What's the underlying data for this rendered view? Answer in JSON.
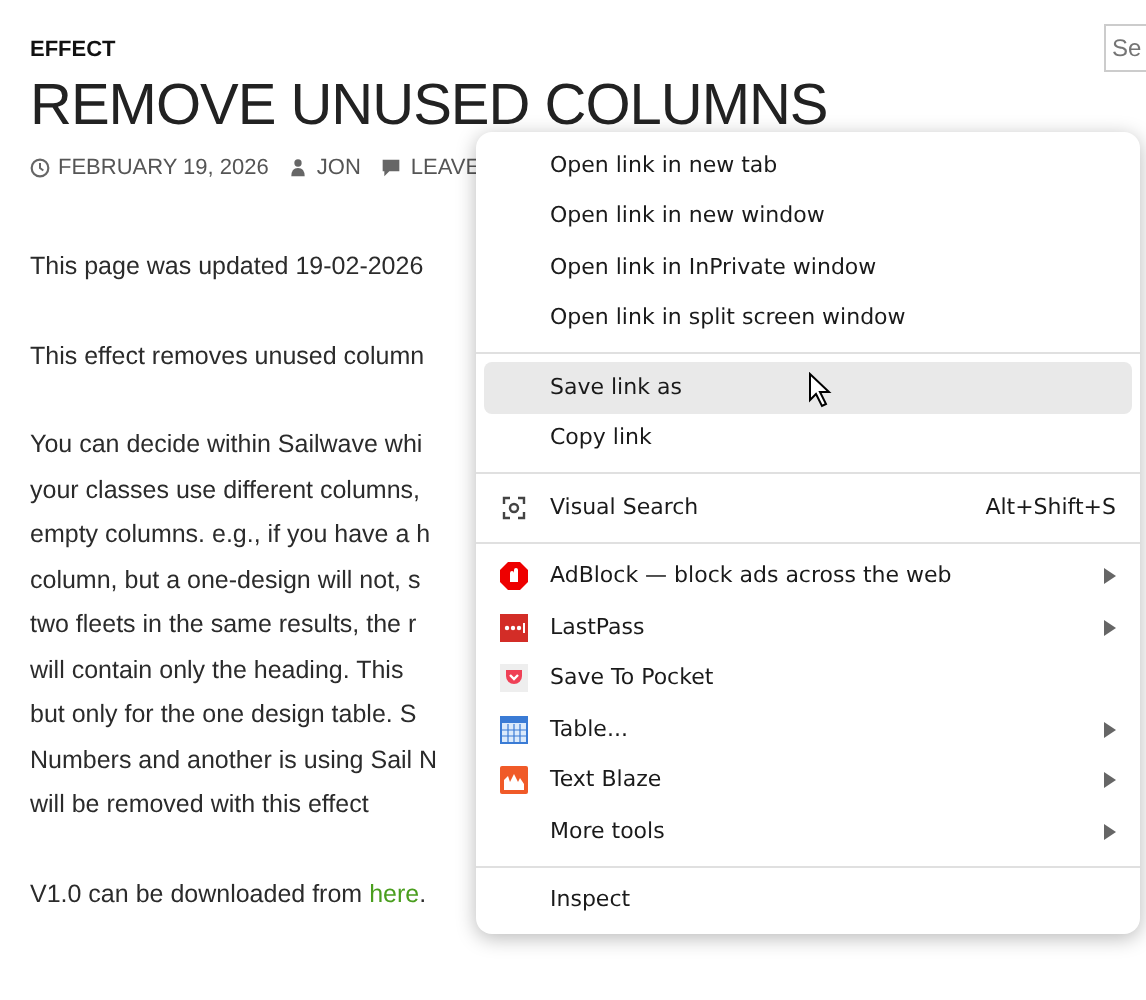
{
  "search": {
    "placeholder": "Se"
  },
  "article": {
    "category": "EFFECT",
    "title": "REMOVE UNUSED COLUMNS",
    "meta": [
      {
        "kind": "date",
        "text": "FEBRUARY 19, 2026"
      },
      {
        "kind": "author",
        "text": "JON"
      },
      {
        "kind": "comments",
        "text": "LEAVE"
      }
    ],
    "paragraphs": [
      [
        "This page was updated 19-02-2026"
      ],
      [
        "This effect removes unused column"
      ],
      [
        "You can decide within Sailwave whi",
        "your classes use different columns,",
        "empty columns.  e.g., if you have a h",
        "column, but a one-design will not, s",
        "two fleets in the same results, the r",
        "will contain only the heading.  This",
        "but only for the one design table.  S",
        "Numbers and another is using Sail N",
        "will be removed with this effect"
      ]
    ],
    "download": {
      "text": "V1.0  can be downloaded from ",
      "link": "here",
      "after": "."
    }
  },
  "context_menu": {
    "groups": [
      [
        {
          "label": "Open link in new tab",
          "selected": false
        },
        {
          "label": "Open link in new window",
          "selected": false
        },
        {
          "label": "Open link in InPrivate window",
          "selected": false
        },
        {
          "label": "Open link in split screen window",
          "selected": false
        }
      ],
      [
        {
          "label": "Save link as",
          "selected": true
        },
        {
          "label": "Copy link",
          "selected": false
        }
      ],
      [
        {
          "label": "Visual Search",
          "shortcut": "Alt+Shift+S",
          "selected": false
        }
      ],
      [
        {
          "label": "AdBlock — block ads across the web",
          "submenu": true,
          "selected": false
        },
        {
          "label": "LastPass",
          "submenu": true,
          "selected": false
        },
        {
          "label": "Save To Pocket",
          "submenu": false,
          "selected": false
        },
        {
          "label": "Table...",
          "submenu": true,
          "selected": false
        },
        {
          "label": "Text Blaze",
          "submenu": true,
          "selected": false
        },
        {
          "label": "More tools",
          "submenu": true,
          "selected": false
        }
      ],
      [
        {
          "label": "Inspect",
          "selected": false
        }
      ]
    ]
  }
}
